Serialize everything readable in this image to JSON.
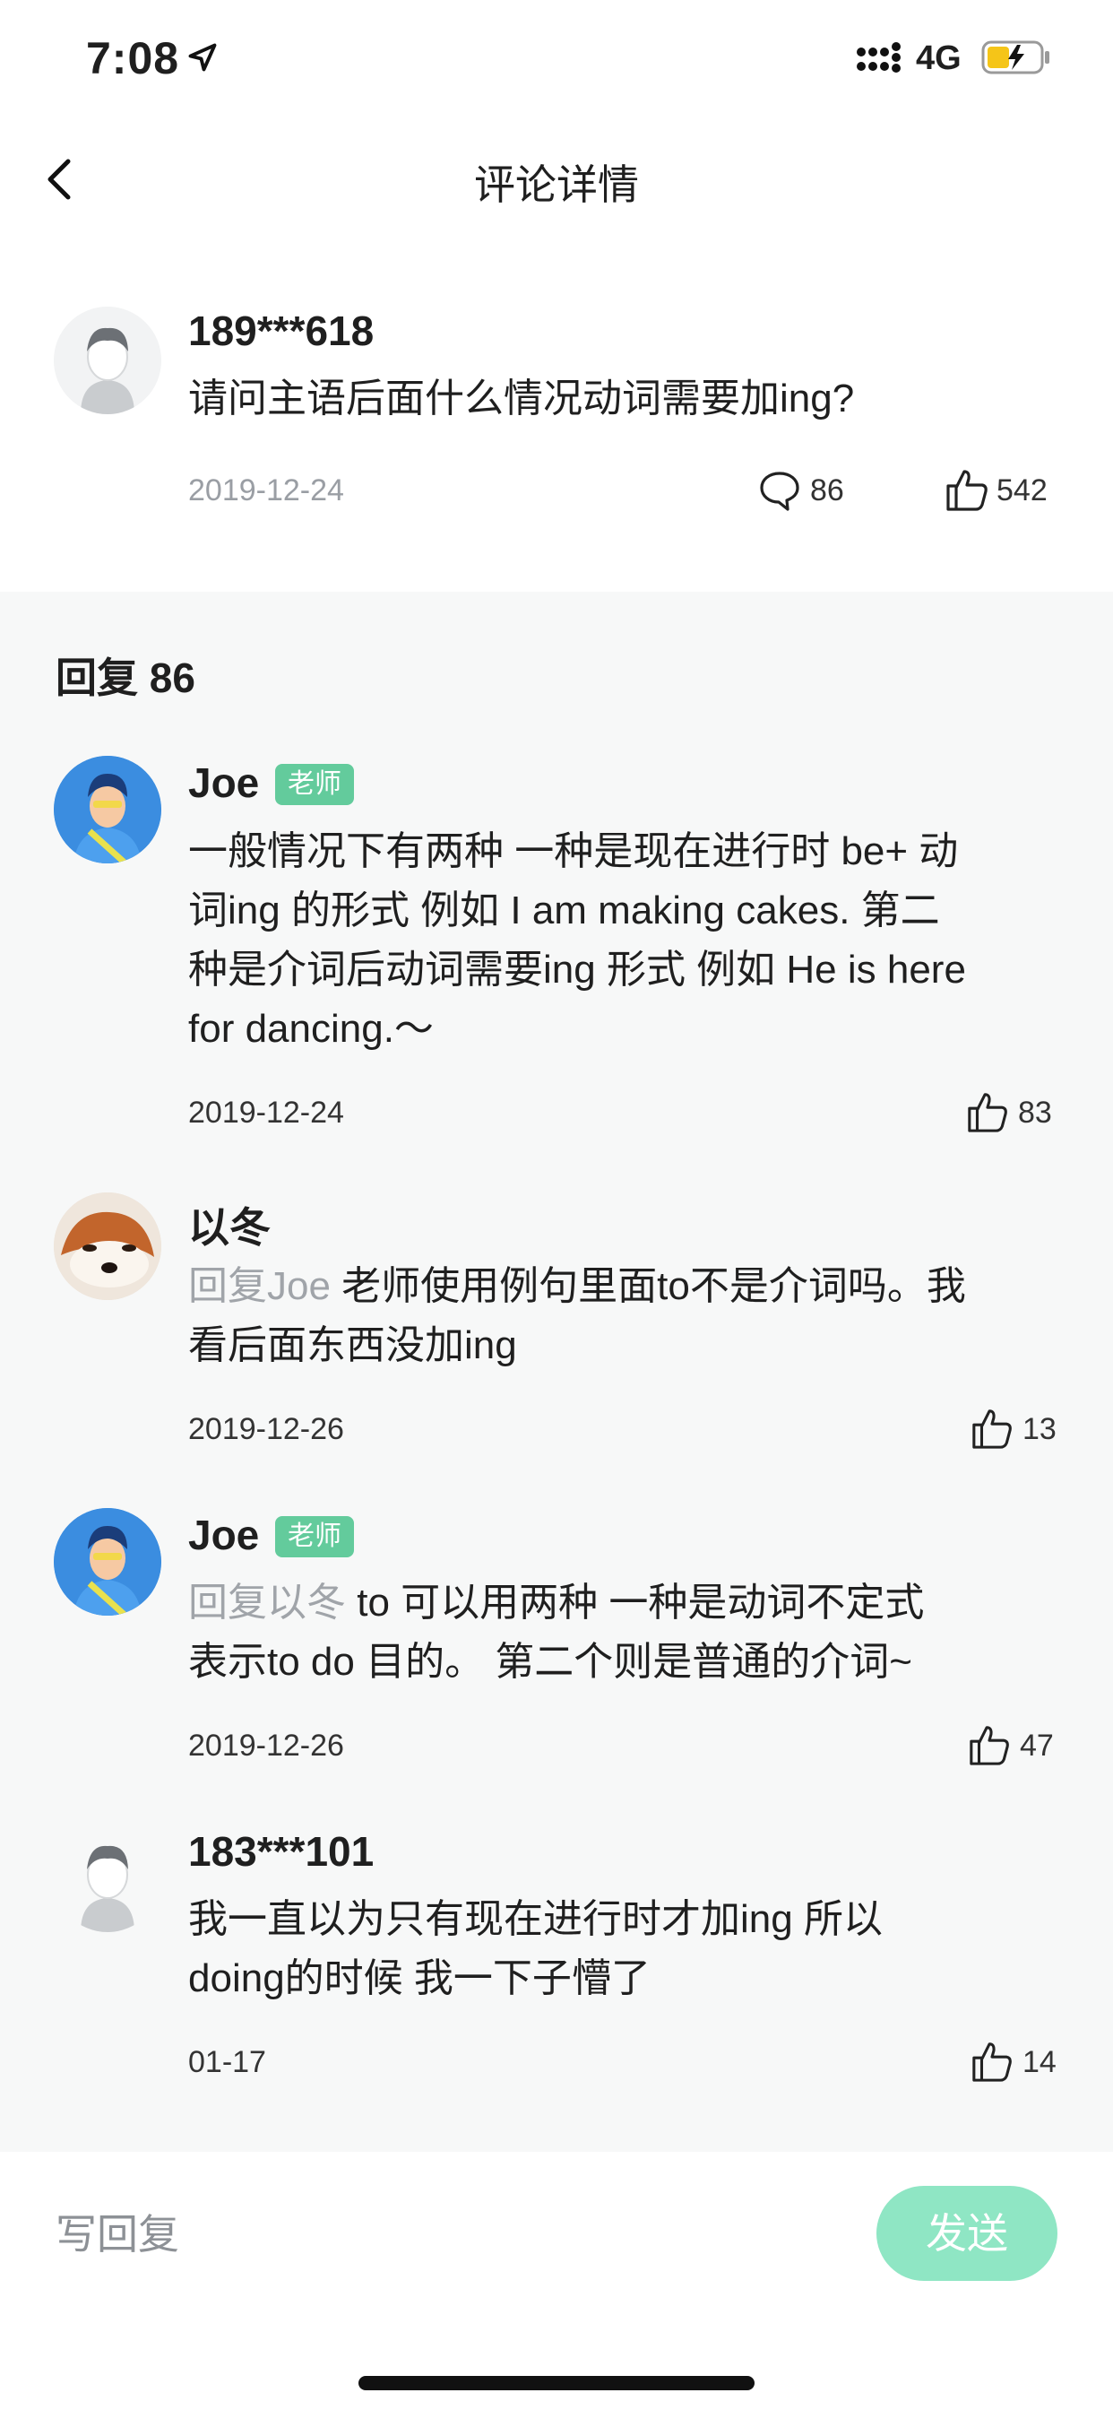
{
  "status_bar": {
    "time": "7:08",
    "network": "4G"
  },
  "nav": {
    "title": "评论详情"
  },
  "main_comment": {
    "username": "189***618",
    "text": "请问主语后面什么情况动词需要加ing?",
    "date": "2019-12-24",
    "comment_count": "86",
    "like_count": "542"
  },
  "replies": {
    "heading": "回复 86",
    "items": [
      {
        "username": "Joe",
        "badge": "老师",
        "line1": "一般情况下有两种 一种是现在进行时 be+ 动",
        "line2": "词ing 的形式 例如 I am making cakes. 第二",
        "line3": "种是介词后动词需要ing 形式 例如 He is here",
        "line4": "for dancing.～",
        "date": "2019-12-24",
        "likes": "83"
      },
      {
        "username": "以冬",
        "reply_to": "回复Joe",
        "line1": " 老师使用例句里面to不是介词吗。我",
        "line2": "看后面东西没加ing",
        "date": "2019-12-26",
        "likes": "13"
      },
      {
        "username": "Joe",
        "badge": "老师",
        "reply_to": "回复以冬",
        "line1": " to 可以用两种 一种是动词不定式",
        "line2": "表示to do 目的。 第二个则是普通的介词~",
        "date": "2019-12-26",
        "likes": "47"
      },
      {
        "username": "183***101",
        "line1": "我一直以为只有现在进行时才加ing 所以",
        "line2": "doing的时候 我一下子懵了",
        "date": "01-17",
        "likes": "14"
      }
    ]
  },
  "input_bar": {
    "placeholder": "写回复",
    "send_label": "发送"
  },
  "colors": {
    "accent": "#63cb9c",
    "send_button": "#8fe6c4",
    "replies_bg": "#f7f8f8",
    "muted": "#a0a4a9"
  },
  "icons": [
    "location-arrow-icon",
    "signal-icon",
    "battery-charging-icon",
    "back-chevron-icon",
    "comment-bubble-icon",
    "thumbs-up-icon",
    "default-avatar-icon",
    "teacher-avatar",
    "dog-avatar"
  ]
}
